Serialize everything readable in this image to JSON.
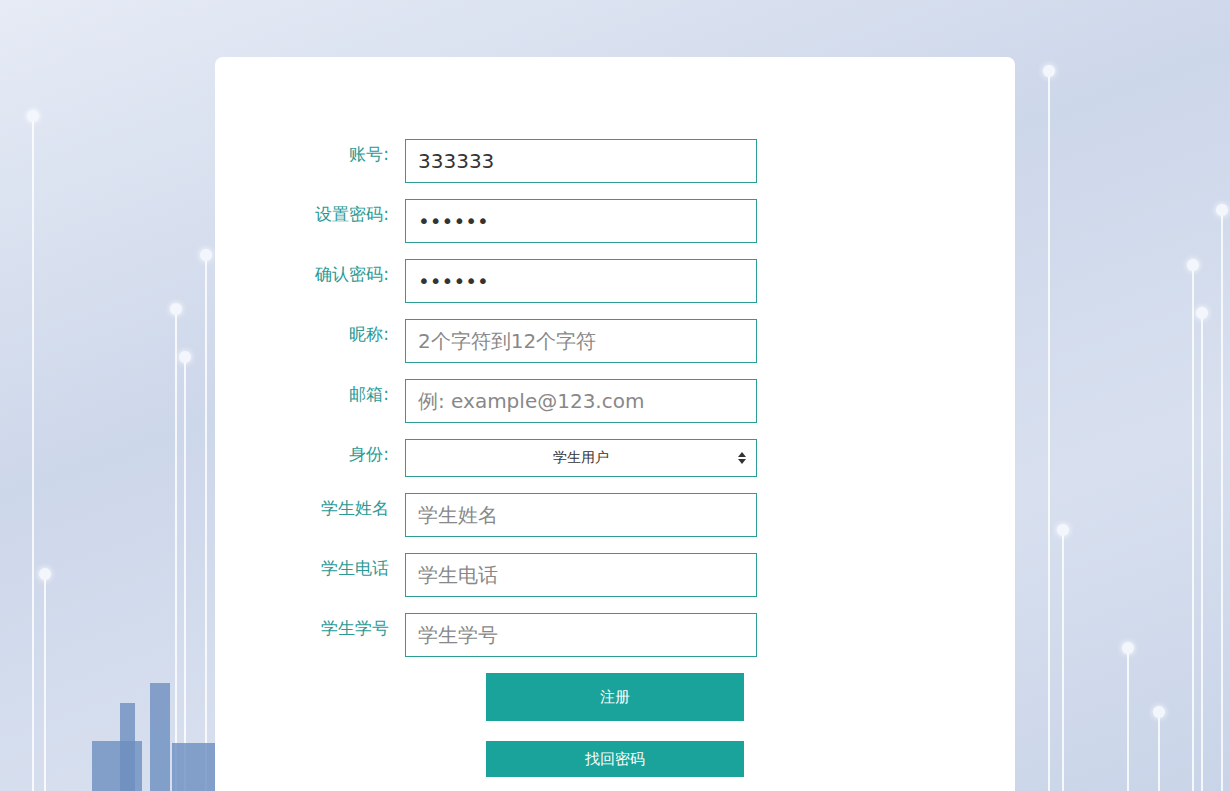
{
  "fields": [
    {
      "label": "账号:",
      "kind": "input",
      "value": "333333",
      "placeholder": ""
    },
    {
      "label": "设置密码:",
      "kind": "input",
      "value": "••••••",
      "placeholder": ""
    },
    {
      "label": "确认密码:",
      "kind": "input",
      "value": "••••••",
      "placeholder": ""
    },
    {
      "label": "昵称:",
      "kind": "input",
      "value": "",
      "placeholder": "2个字符到12个字符"
    },
    {
      "label": "邮箱:",
      "kind": "input",
      "value": "",
      "placeholder": "例: example@123.com"
    },
    {
      "label": "身份:",
      "kind": "select",
      "value": "学生用户",
      "placeholder": ""
    },
    {
      "label": "学生姓名",
      "kind": "input",
      "value": "",
      "placeholder": "学生姓名"
    },
    {
      "label": "学生电话",
      "kind": "input",
      "value": "",
      "placeholder": "学生电话"
    },
    {
      "label": "学生学号",
      "kind": "input",
      "value": "",
      "placeholder": "学生学号"
    }
  ],
  "buttons": [
    "注册",
    "找回密码"
  ]
}
